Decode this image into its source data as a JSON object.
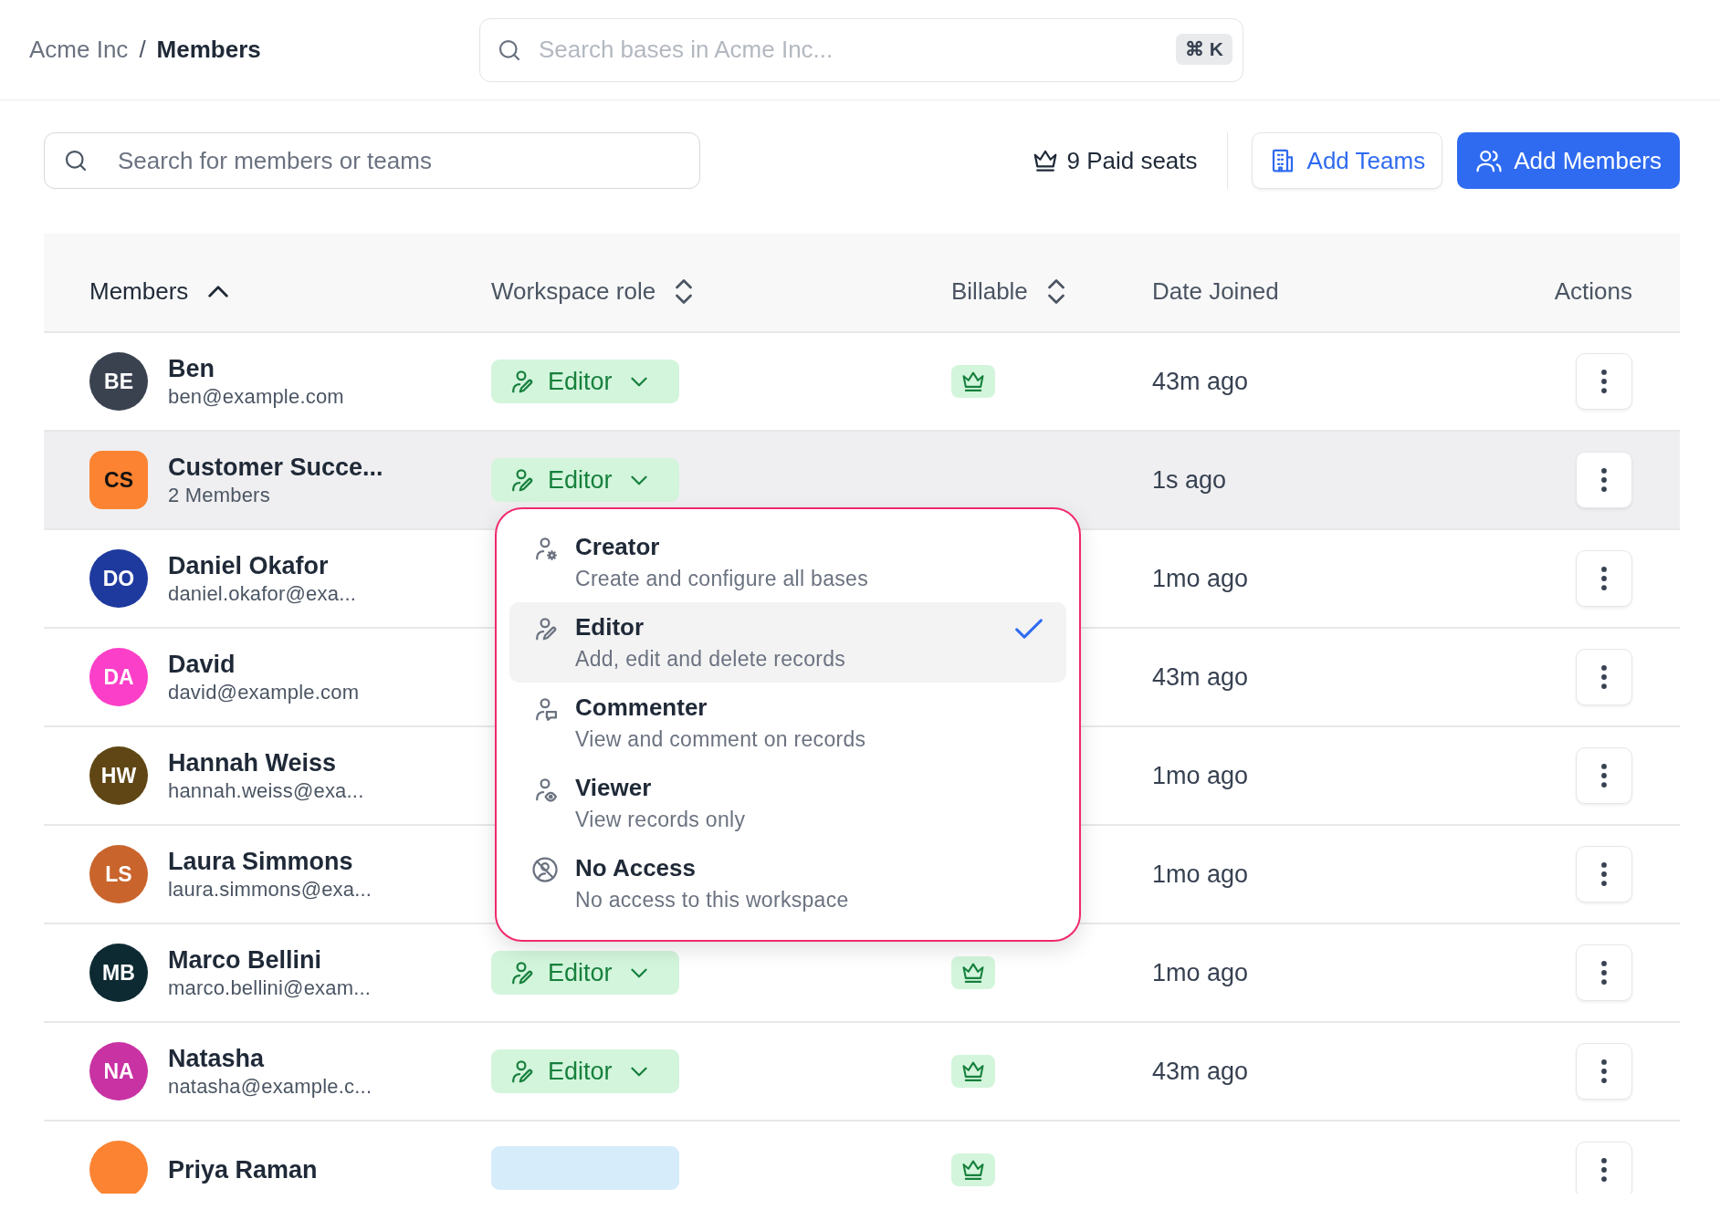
{
  "breadcrumb": {
    "parent": "Acme Inc",
    "separator": "/",
    "current": "Members"
  },
  "global_search": {
    "placeholder": "Search bases in Acme Inc...",
    "shortcut": "⌘ K"
  },
  "member_search": {
    "placeholder": "Search for members or teams"
  },
  "paid_seats": "9 Paid seats",
  "buttons": [
    {
      "label": "Add Teams",
      "kind": "secondary"
    },
    {
      "label": "Add Members",
      "kind": "primary"
    }
  ],
  "table": {
    "columns": [
      {
        "label": "Members",
        "kind": "sorted"
      },
      {
        "label": "Workspace role",
        "kind": "sortable"
      },
      {
        "label": "Billable",
        "kind": "sortable"
      },
      {
        "label": "Date Joined",
        "kind": "plain"
      },
      {
        "label": "Actions",
        "kind": "plain"
      }
    ],
    "rows": [
      {
        "kind": "person",
        "name": "Ben",
        "detail": "ben@example.com",
        "initials": "BE",
        "color": "#3a4250",
        "role": {
          "label": "Editor",
          "color": "#d3f5dc"
        },
        "billable": true,
        "joined": "43m ago",
        "highlighted": false
      },
      {
        "kind": "team",
        "name": "Customer Succe...",
        "detail": "2 Members",
        "initials": "CS",
        "color": "#fb8332",
        "role": {
          "label": "Editor",
          "color": "#d3f5dc"
        },
        "billable": false,
        "joined": "1s ago",
        "highlighted": true
      },
      {
        "kind": "person",
        "name": "Daniel Okafor",
        "detail": "daniel.okafor@exa...",
        "initials": "DO",
        "color": "#1e3a9e",
        "joined": "1mo ago",
        "highlighted": false
      },
      {
        "kind": "person",
        "name": "David",
        "detail": "david@example.com",
        "initials": "DA",
        "color": "#fb3fc8",
        "joined": "43m ago",
        "highlighted": false
      },
      {
        "kind": "person",
        "name": "Hannah Weiss",
        "detail": "hannah.weiss@exa...",
        "initials": "HW",
        "color": "#5f4614",
        "joined": "1mo ago",
        "highlighted": false
      },
      {
        "kind": "person",
        "name": "Laura Simmons",
        "detail": "laura.simmons@exa...",
        "initials": "LS",
        "color": "#c9642c",
        "joined": "1mo ago",
        "highlighted": false
      },
      {
        "kind": "person",
        "name": "Marco Bellini",
        "detail": "marco.bellini@exam...",
        "initials": "MB",
        "color": "#0d2a33",
        "role": {
          "label": "Editor",
          "color": "#d3f5dc"
        },
        "billable": true,
        "joined": "1mo ago",
        "highlighted": false
      },
      {
        "kind": "person",
        "name": "Natasha",
        "detail": "natasha@example.c...",
        "initials": "NA",
        "color": "#c832a3",
        "role": {
          "label": "Editor",
          "color": "#d3f5dc"
        },
        "billable": true,
        "joined": "43m ago",
        "highlighted": false
      },
      {
        "kind": "person",
        "name": "Priya Raman",
        "color": "#fb8332",
        "role": {
          "color": "#d6ecfb"
        },
        "billable": true,
        "highlighted": false
      }
    ]
  },
  "role_menu": {
    "options": [
      {
        "kind": "creator",
        "label": "Creator",
        "description": "Create and configure all bases",
        "selected": false
      },
      {
        "kind": "editor",
        "label": "Editor",
        "description": "Add, edit and delete records",
        "selected": true
      },
      {
        "kind": "commenter",
        "label": "Commenter",
        "description": "View and comment on records",
        "selected": false
      },
      {
        "kind": "viewer",
        "label": "Viewer",
        "description": "View records only",
        "selected": false
      },
      {
        "kind": "none",
        "label": "No Access",
        "description": "No access to this workspace",
        "selected": false
      }
    ]
  }
}
